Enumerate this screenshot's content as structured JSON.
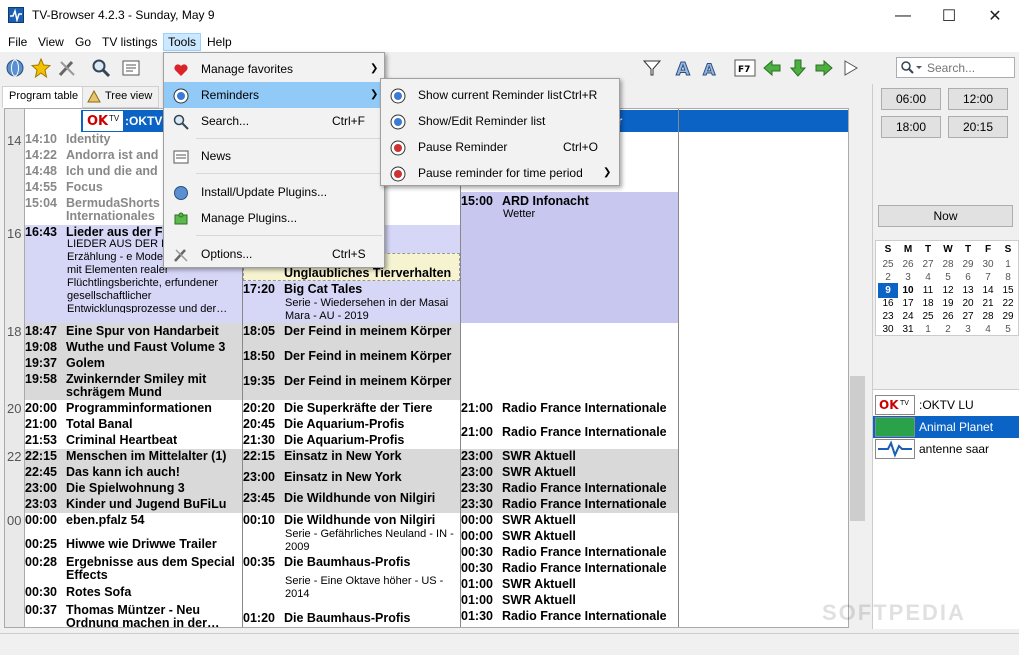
{
  "window": {
    "title": "TV-Browser 4.2.3 - Sunday, May 9",
    "min": "—",
    "max": "☐",
    "close": "✕"
  },
  "menubar": [
    "File",
    "View",
    "Go",
    "TV listings",
    "Tools",
    "Help"
  ],
  "search": {
    "placeholder": "Search..."
  },
  "tabs": {
    "program": "Program table",
    "tree": "Tree view"
  },
  "tools_menu": {
    "items": [
      {
        "label": "Manage favorites",
        "shortcut": "",
        "sub": true
      },
      {
        "label": "Reminders",
        "shortcut": "",
        "sub": true
      },
      {
        "label": "Search...",
        "shortcut": "Ctrl+F",
        "sub": false
      },
      {
        "label": "News",
        "shortcut": "",
        "sub": false
      },
      {
        "label": "Install/Update Plugins...",
        "shortcut": "",
        "sub": false
      },
      {
        "label": "Manage Plugins...",
        "shortcut": "",
        "sub": false
      },
      {
        "label": "Options...",
        "shortcut": "Ctrl+S",
        "sub": false
      }
    ]
  },
  "reminders_menu": {
    "items": [
      {
        "label": "Show current Reminder list",
        "shortcut": "Ctrl+R"
      },
      {
        "label": "Show/Edit Reminder list",
        "shortcut": ""
      },
      {
        "label": "Pause Reminder",
        "shortcut": "Ctrl+O"
      },
      {
        "label": "Pause reminder for time period",
        "shortcut": ""
      }
    ]
  },
  "channel_header": {
    "first": ":OKTV",
    "third": "ar"
  },
  "hours": [
    "14",
    "16",
    "18",
    "20",
    "22",
    "00"
  ],
  "col1": [
    {
      "t": "14:10",
      "n": "Identity"
    },
    {
      "t": "14:22",
      "n": "Andorra ist and"
    },
    {
      "t": "14:48",
      "n": "Ich und die and"
    },
    {
      "t": "14:55",
      "n": "Focus"
    },
    {
      "t": "15:04",
      "n": "BermudaShorts"
    },
    {
      "t": "",
      "n": "Internationales"
    },
    {
      "t": "16:43",
      "n": "Lieder aus der F"
    },
    {
      "t": "18:47",
      "n": "Eine Spur von Handarbeit"
    },
    {
      "t": "19:08",
      "n": "Wuthe und Faust Volume 3"
    },
    {
      "t": "19:37",
      "n": "Golem"
    },
    {
      "t": "19:58",
      "n": "Zwinkernder Smiley mit"
    },
    {
      "t": "",
      "n": "schrägem Mund"
    },
    {
      "t": "20:00",
      "n": "Programminformationen"
    },
    {
      "t": "21:00",
      "n": "Total Banal"
    },
    {
      "t": "21:53",
      "n": "Criminal Heartbeat"
    },
    {
      "t": "22:15",
      "n": "Menschen im Mittelalter (1)"
    },
    {
      "t": "22:45",
      "n": "Das kann ich auch!"
    },
    {
      "t": "23:00",
      "n": "Die Spielwohnung 3"
    },
    {
      "t": "23:03",
      "n": "Kinder und Jugend BuFiLu"
    },
    {
      "t": "00:00",
      "n": "eben.pfalz 54"
    },
    {
      "t": "00:25",
      "n": "Hiwwe wie Driwwe Trailer"
    },
    {
      "t": "00:28",
      "n": "Ergebnisse aus dem Special"
    },
    {
      "t": "",
      "n": "Effects"
    },
    {
      "t": "00:30",
      "n": "Rotes Sofa"
    },
    {
      "t": "00:37",
      "n": "Thomas Müntzer - Neu"
    },
    {
      "t": "",
      "n": "Ordnung machen in der…"
    }
  ],
  "col1_desc": "LIEDER AUS DER FR fiktive Erzählung - e Modernes Märchen mit Elementen realer Flüchtlingsberichte, erfundener gesellschaftlicher Entwicklungsprozesse und der…",
  "col2": [
    {
      "t": "",
      "n": "weißer Wolf…"
    },
    {
      "t": "",
      "n": "erverhalten"
    },
    {
      "t": "",
      "n": "Unglaubliches Tierverhalten"
    },
    {
      "t": "17:20",
      "n": "Big Cat Tales"
    },
    {
      "t": "18:05",
      "n": "Der Feind in meinem Körper"
    },
    {
      "t": "18:50",
      "n": "Der Feind in meinem Körper"
    },
    {
      "t": "19:35",
      "n": "Der Feind in meinem Körper"
    },
    {
      "t": "20:20",
      "n": "Die Superkräfte der Tiere"
    },
    {
      "t": "20:45",
      "n": "Die Aquarium-Profis"
    },
    {
      "t": "21:30",
      "n": "Die Aquarium-Profis"
    },
    {
      "t": "22:15",
      "n": "Einsatz in New York"
    },
    {
      "t": "23:00",
      "n": "Einsatz in New York"
    },
    {
      "t": "23:45",
      "n": "Die Wildhunde von Nilgiri"
    },
    {
      "t": "00:10",
      "n": "Die Wildhunde von Nilgiri"
    },
    {
      "t": "00:35",
      "n": "Die Baumhaus-Profis"
    },
    {
      "t": "01:20",
      "n": "Die Baumhaus-Profis"
    }
  ],
  "col2_desc": {
    "bigcat": "Serie - Wiedersehen in der Masai Mara - AU - 2019",
    "wild": "Serie - Gefährliches Neuland - IN - 2009",
    "baum": "Serie - Eine Oktave höher - US - 2014"
  },
  "col3": [
    {
      "t": "15:00",
      "n": "ARD Infonacht"
    },
    {
      "t": "21:00",
      "n": "Radio France Internationale"
    },
    {
      "t": "21:00",
      "n": "Radio France Internationale"
    },
    {
      "t": "23:00",
      "n": "SWR Aktuell"
    },
    {
      "t": "23:00",
      "n": "SWR Aktuell"
    },
    {
      "t": "23:30",
      "n": "Radio France Internationale"
    },
    {
      "t": "23:30",
      "n": "Radio France Internationale"
    },
    {
      "t": "00:00",
      "n": "SWR Aktuell"
    },
    {
      "t": "00:00",
      "n": "SWR Aktuell"
    },
    {
      "t": "00:30",
      "n": "Radio France Internationale"
    },
    {
      "t": "00:30",
      "n": "Radio France Internationale"
    },
    {
      "t": "01:00",
      "n": "SWR Aktuell"
    },
    {
      "t": "01:00",
      "n": "SWR Aktuell"
    },
    {
      "t": "01:30",
      "n": "Radio France Internationale"
    }
  ],
  "col3_sub": "Wetter",
  "right": {
    "times": [
      "06:00",
      "12:00",
      "18:00",
      "20:15"
    ],
    "now": "Now"
  },
  "calendar": {
    "days": [
      "S",
      "M",
      "T",
      "W",
      "T",
      "F",
      "S"
    ],
    "rows": [
      [
        "25",
        "26",
        "27",
        "28",
        "29",
        "30",
        "1"
      ],
      [
        "2",
        "3",
        "4",
        "5",
        "6",
        "7",
        "8"
      ],
      [
        "9",
        "10",
        "11",
        "12",
        "13",
        "14",
        "15"
      ],
      [
        "16",
        "17",
        "18",
        "19",
        "20",
        "21",
        "22"
      ],
      [
        "23",
        "24",
        "25",
        "26",
        "27",
        "28",
        "29"
      ],
      [
        "30",
        "31",
        "1",
        "2",
        "3",
        "4",
        "5"
      ]
    ]
  },
  "channels": [
    ":OKTV LU",
    "Animal Planet",
    "antenne saar"
  ],
  "watermark": "SOFTPEDIA",
  "colors": {
    "accent": "#0b63c5",
    "selection": "#91c9f7",
    "past": "#d9d9d9",
    "current": "#d6d6f7"
  }
}
